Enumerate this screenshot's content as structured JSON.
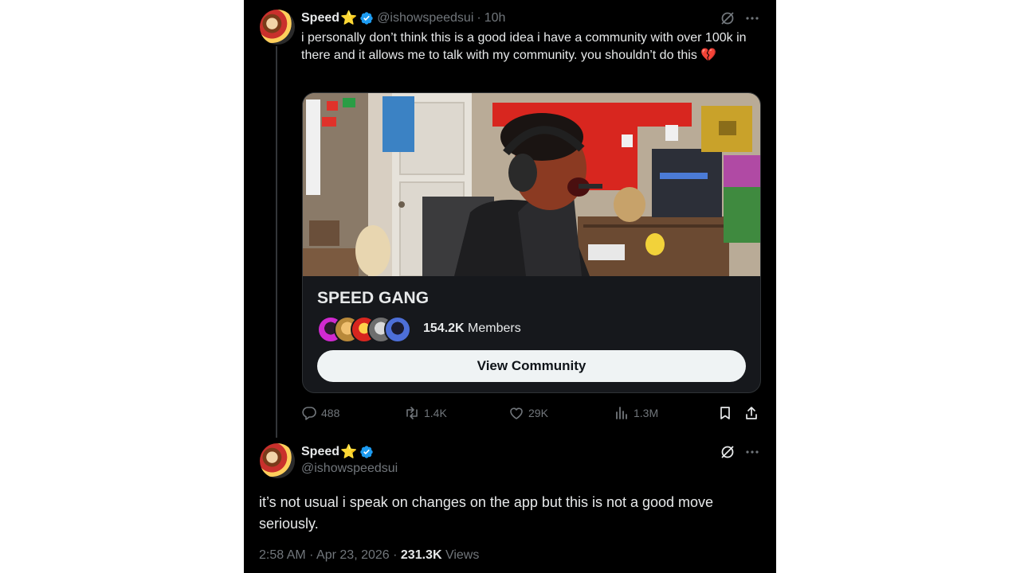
{
  "tweet1": {
    "name": "Speed",
    "name_emoji": "⭐",
    "handle": "@ishowspeedsui",
    "separator": "·",
    "time": "10h",
    "text": "i personally don’t think this is a good idea i have a community with over 100k in there and it allows me to talk with my community. you shouldn’t do this 💔",
    "card": {
      "title": "SPEED GANG",
      "members_count": "154.2K",
      "members_label": "Members",
      "button_label": "View Community"
    },
    "actions": {
      "replies": "488",
      "reposts": "1.4K",
      "likes": "29K",
      "views": "1.3M"
    }
  },
  "tweet2": {
    "name": "Speed",
    "name_emoji": "⭐",
    "handle": "@ishowspeedsui",
    "text": "it’s not usual i speak on changes on the app but this is not a good move seriously.",
    "time": "2:58 AM",
    "date": "Apr 23, 2026",
    "separator": "·",
    "views_count": "231.3K",
    "views_label": "Views"
  },
  "colors": {
    "background": "#000000",
    "text": "#e7e9ea",
    "secondary_text": "#71767b",
    "verified_blue": "#1d9bf0",
    "button_bg": "#eff3f4"
  },
  "icons": [
    "verified-badge-icon",
    "grok-icon",
    "more-icon",
    "reply-icon",
    "repost-icon",
    "like-icon",
    "views-icon",
    "bookmark-icon",
    "share-icon"
  ]
}
